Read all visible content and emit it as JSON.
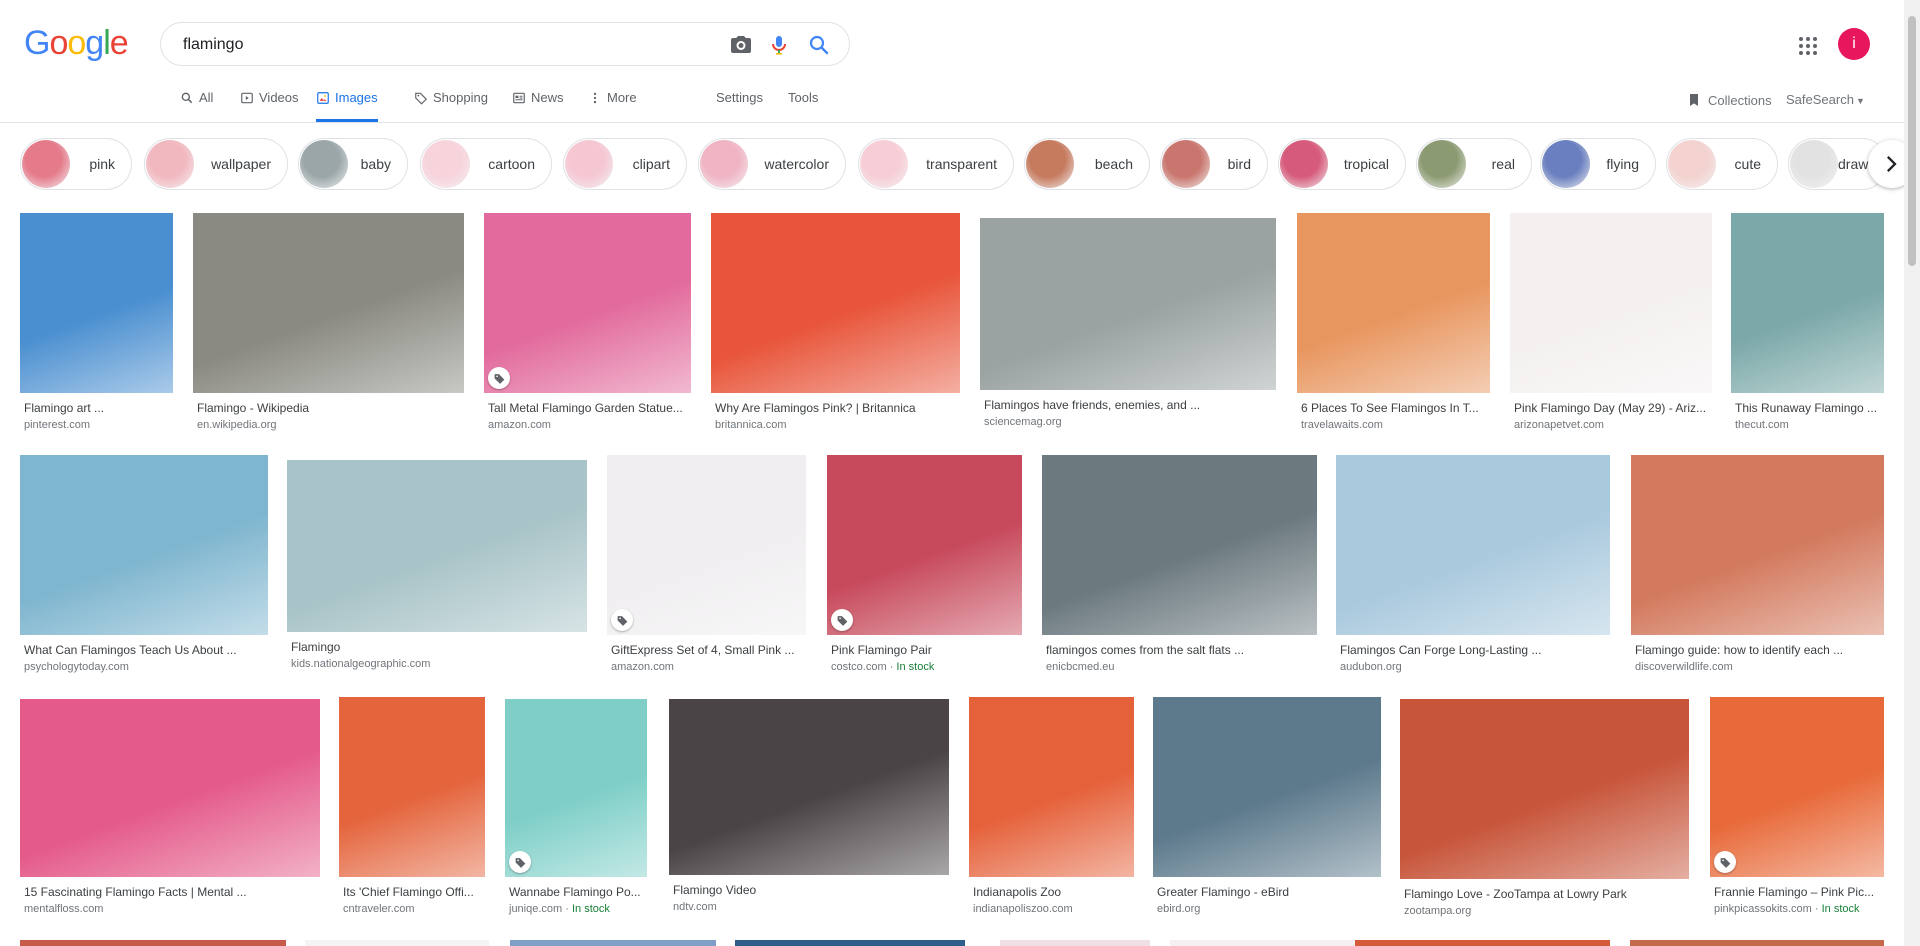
{
  "logo": {
    "letters": [
      "G",
      "o",
      "o",
      "g",
      "l",
      "e"
    ],
    "colors": [
      "#4285F4",
      "#EA4335",
      "#FBBC05",
      "#4285F4",
      "#34A853",
      "#EA4335"
    ]
  },
  "search": {
    "value": "flamingo"
  },
  "nav": {
    "tabs": [
      {
        "label": "All",
        "icon": "search-icon"
      },
      {
        "label": "Videos",
        "icon": "video-icon"
      },
      {
        "label": "Images",
        "icon": "image-icon",
        "active": true
      },
      {
        "label": "Shopping",
        "icon": "tag-icon"
      },
      {
        "label": "News",
        "icon": "news-icon"
      },
      {
        "label": "More",
        "icon": "more-icon"
      },
      {
        "label": "Settings"
      },
      {
        "label": "Tools"
      }
    ],
    "collections": "Collections",
    "safesearch": "SafeSearch"
  },
  "user": {
    "avatar_letter": "i",
    "avatar_color": "#e8175d"
  },
  "chips": [
    {
      "label": "pink",
      "color": "#e57a8a"
    },
    {
      "label": "wallpaper",
      "color": "#f2b8c0"
    },
    {
      "label": "baby",
      "color": "#9aa6a8"
    },
    {
      "label": "cartoon",
      "color": "#f7d3db"
    },
    {
      "label": "clipart",
      "color": "#f5c7d3"
    },
    {
      "label": "watercolor",
      "color": "#f0b4c4"
    },
    {
      "label": "transparent",
      "color": "#f7cdd6"
    },
    {
      "label": "beach",
      "color": "#c67a5e"
    },
    {
      "label": "bird",
      "color": "#c9766e"
    },
    {
      "label": "tropical",
      "color": "#d65a7b"
    },
    {
      "label": "real",
      "color": "#8c9a72"
    },
    {
      "label": "flying",
      "color": "#6a7fbf"
    },
    {
      "label": "cute",
      "color": "#f3d2cf"
    },
    {
      "label": "drawing",
      "color": "#e2e2e2"
    }
  ],
  "results": [
    {
      "title": "Flamingo art ...",
      "source": "pinterest.com",
      "color": "#4a8fd0"
    },
    {
      "title": "Flamingo - Wikipedia",
      "source": "en.wikipedia.org",
      "color": "#8a8a82"
    },
    {
      "title": "Tall Metal Flamingo Garden Statue...",
      "source": "amazon.com",
      "color": "#e26a9c",
      "tag": true
    },
    {
      "title": "Why Are Flamingos Pink? | Britannica",
      "source": "britannica.com",
      "color": "#e8553a"
    },
    {
      "title": "Flamingos have friends, enemies, and ...",
      "source": "sciencemag.org",
      "color": "#9aa2a2"
    },
    {
      "title": "6 Places To See Flamingos In T...",
      "source": "travelawaits.com",
      "color": "#e8965f"
    },
    {
      "title": "Pink Flamingo Day (May 29) - Ariz...",
      "source": "arizonapetvet.com",
      "color": "#f4f0f0"
    },
    {
      "title": "This Runaway Flamingo ...",
      "source": "thecut.com",
      "color": "#7ba8a8"
    },
    {
      "title": "What Can Flamingos Teach Us About ...",
      "source": "psychologytoday.com",
      "color": "#7fb6cf"
    },
    {
      "title": "Flamingo",
      "source": "kids.nationalgeographic.com",
      "color": "#a9c4c8"
    },
    {
      "title": "GiftExpress Set of 4, Small Pink ...",
      "source": "amazon.com",
      "color": "#f0eef0",
      "tag": true
    },
    {
      "title": "Pink Flamingo Pair",
      "source": "costco.com",
      "stock": "In stock",
      "color": "#c74a5c",
      "tag": true
    },
    {
      "title": "flamingos comes from the salt flats ...",
      "source": "enicbcmed.eu",
      "color": "#6c7a80"
    },
    {
      "title": "Flamingos Can Forge Long-Lasting ...",
      "source": "audubon.org",
      "color": "#a9c9dd"
    },
    {
      "title": "Flamingo guide: how to identify each ...",
      "source": "discoverwildlife.com",
      "color": "#d37a5e"
    },
    {
      "title": "15 Fascinating Flamingo Facts | Mental ...",
      "source": "mentalfloss.com",
      "color": "#e45a8a"
    },
    {
      "title": "Its 'Chief Flamingo Offi...",
      "source": "cntraveler.com",
      "color": "#e4643c"
    },
    {
      "title": "Wannabe Flamingo Po...",
      "source": "juniqe.com",
      "stock": "In stock",
      "color": "#7fcfc8",
      "tag": true
    },
    {
      "title": "Flamingo Video",
      "source": "ndtv.com",
      "color": "#4a4446"
    },
    {
      "title": "Indianapolis Zoo",
      "source": "indianapoliszoo.com",
      "color": "#e5613a"
    },
    {
      "title": "Greater Flamingo - eBird",
      "source": "ebird.org",
      "color": "#5d7a8c"
    },
    {
      "title": "Flamingo Love - ZooTampa at Lowry Park",
      "source": "zootampa.org",
      "color": "#c7553a"
    },
    {
      "title": "Frannie Flamingo – Pink Pic...",
      "source": "pinkpicassokits.com",
      "stock": "In stock",
      "color": "#e86a3a",
      "tag": true
    }
  ],
  "stock_separator": " · ",
  "peek_colors": [
    "#c85a4a",
    "#f4f4f4",
    "#7f9fc8",
    "#2d5f8a",
    "#f0e0e4",
    "#f4f0f0",
    "#d45a3a",
    "#c46a4a"
  ]
}
